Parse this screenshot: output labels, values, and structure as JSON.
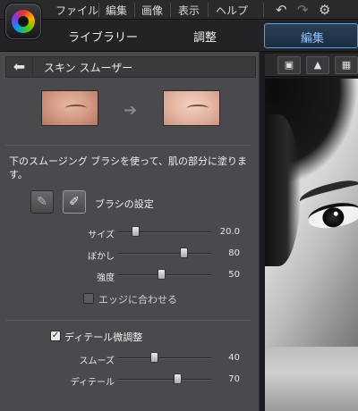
{
  "menu": {
    "items": [
      "ファイル",
      "編集",
      "画像",
      "表示",
      "ヘルプ"
    ],
    "icons": [
      "undo-icon",
      "redo-icon",
      "gear-icon"
    ]
  },
  "nav": {
    "library": "ライブラリー",
    "adjust": "調整",
    "edit": "編集"
  },
  "panel": {
    "title": "スキン スムーザー",
    "description": "下のスムージング ブラシを使って、肌の部分に塗ります。",
    "brush_settings_label": "ブラシの設定",
    "sliders": [
      {
        "label": "サイズ",
        "value": "20.0",
        "level": 0.15
      },
      {
        "label": "ぼかし",
        "value": "80",
        "level": 0.8
      },
      {
        "label": "強度",
        "value": "50",
        "level": 0.5
      }
    ],
    "fit_edges": {
      "label": "エッジに合わせる",
      "checked": false
    },
    "detail": {
      "label": "ディテール微調整",
      "checked": true,
      "sliders": [
        {
          "label": "スムーズ",
          "value": "40",
          "level": 0.4
        },
        {
          "label": "ディテール",
          "value": "70",
          "level": 0.7
        }
      ]
    }
  },
  "colors": {
    "accent": "#5aa0df",
    "panel": "#4a4a4e"
  }
}
